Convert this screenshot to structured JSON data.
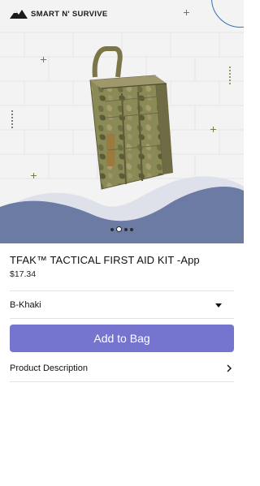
{
  "brand": {
    "name": "SMART N' SURVIVE"
  },
  "carousel": {
    "page_count": 4,
    "active_index": 1
  },
  "product": {
    "title": "TFAK™ TACTICAL FIRST AID KIT -App",
    "price": "$17.34"
  },
  "variant": {
    "selected": "B-Khaki"
  },
  "actions": {
    "add_to_bag": "Add to Bag"
  },
  "description_row": {
    "label": "Product Description"
  },
  "colors": {
    "button": "#7574cf",
    "wave": "#6b7ba4"
  }
}
